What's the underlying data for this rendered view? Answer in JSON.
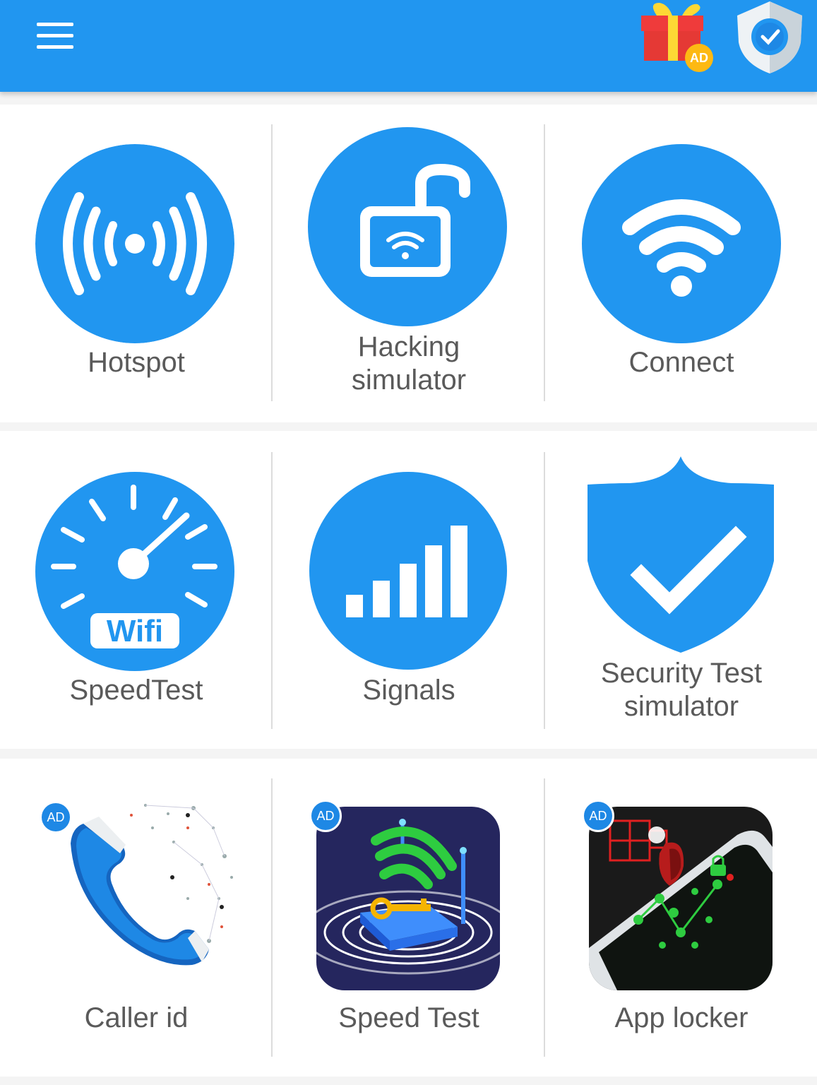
{
  "appbar": {
    "menu_icon": "hamburger-menu-icon",
    "gift_icon": "gift-icon",
    "gift_badge": "AD",
    "shield_icon": "shield-check-icon"
  },
  "colors": {
    "primary": "#2196f0",
    "ad_badge": "#1e88e5",
    "gift_badge": "#fdb913"
  },
  "features": [
    {
      "label": "Hotspot",
      "icon": "hotspot-icon"
    },
    {
      "label": "Hacking\nsimulator",
      "icon": "unlocked-padlock-wifi-icon"
    },
    {
      "label": "Connect",
      "icon": "wifi-icon"
    },
    {
      "label": "SpeedTest",
      "icon": "speedometer-icon",
      "icon_text": "Wifi"
    },
    {
      "label": "Signals",
      "icon": "signal-bars-icon"
    },
    {
      "label": "Security Test\nsimulator",
      "icon": "shield-check-icon"
    }
  ],
  "ads": [
    {
      "label": "Caller id",
      "badge": "AD",
      "icon": "phone-handset-icon"
    },
    {
      "label": "Speed Test",
      "badge": "AD",
      "icon": "router-key-icon"
    },
    {
      "label": "App locker",
      "badge": "AD",
      "icon": "phone-pattern-lock-icon"
    }
  ]
}
